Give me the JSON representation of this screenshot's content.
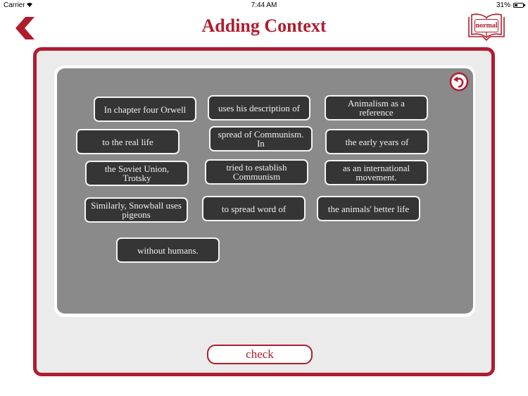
{
  "status_bar": {
    "carrier": "Carrier",
    "wifi_icon": "wifi-icon",
    "time": "7:44 AM",
    "battery_percent": "31%",
    "battery_level": 0.31
  },
  "header": {
    "back_icon": "chevron-left-icon",
    "title": "Adding Context",
    "mode_icon": "open-book-icon",
    "mode_label": "normal"
  },
  "board": {
    "reset_icon": "undo-arrow-icon",
    "chips": [
      {
        "text": "In chapter four Orwell"
      },
      {
        "text": "uses his description of"
      },
      {
        "text": "Animalism as a reference"
      },
      {
        "text": "to the real life"
      },
      {
        "text": "spread of Communism. In"
      },
      {
        "text": "the early years of"
      },
      {
        "text": "the Soviet Union, Trotsky"
      },
      {
        "text": "tried to establish Communism"
      },
      {
        "text": "as an international movement."
      },
      {
        "text": "Similarly, Snowball uses pigeons"
      },
      {
        "text": "to spread word of"
      },
      {
        "text": "the animals' better life"
      },
      {
        "text": "without humans."
      }
    ]
  },
  "actions": {
    "check_label": "check"
  },
  "colors": {
    "accent": "#b01c2e",
    "board": "#8a8a8a",
    "chip": "#353535",
    "panel": "#ebebeb"
  }
}
